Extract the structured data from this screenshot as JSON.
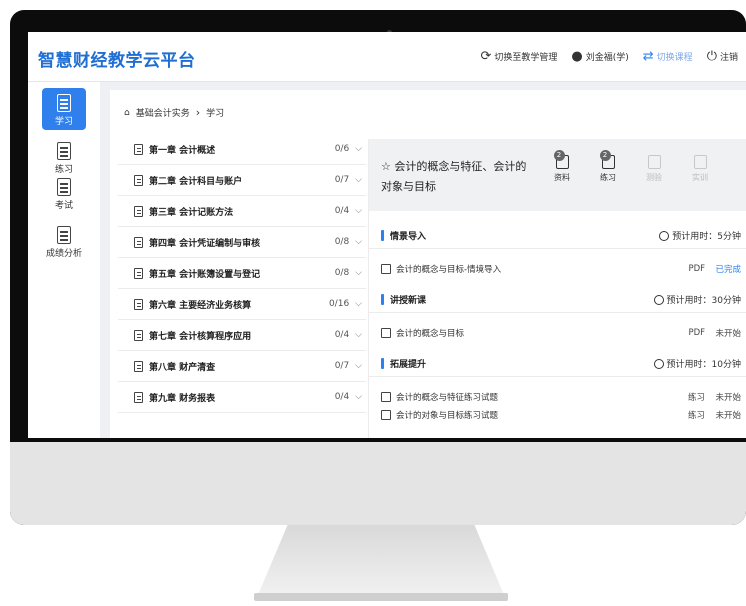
{
  "app": {
    "title": "智慧财经教学云平台"
  },
  "topnav": {
    "switch_admin": "切换至教学管理",
    "user": "刘金福(学)",
    "switch_course": "切换课程",
    "logout": "注销"
  },
  "sidebar": {
    "items": [
      {
        "label": "学习",
        "icon": "book-icon"
      },
      {
        "label": "练习",
        "icon": "document-icon"
      },
      {
        "label": "考试",
        "icon": "save-icon"
      },
      {
        "label": "成绩分析",
        "icon": "report-icon"
      }
    ]
  },
  "breadcrumb": {
    "course": "基础会计实务",
    "current": "学习"
  },
  "chapters": [
    {
      "title": "第一章 会计概述",
      "count": "0/6"
    },
    {
      "title": "第二章 会计科目与账户",
      "count": "0/7"
    },
    {
      "title": "第三章 会计记账方法",
      "count": "0/4"
    },
    {
      "title": "第四章 会计凭证编制与审核",
      "count": "0/8"
    },
    {
      "title": "第五章 会计账簿设置与登记",
      "count": "0/8"
    },
    {
      "title": "第六章 主要经济业务核算",
      "count": "0/16"
    },
    {
      "title": "第七章 会计核算程序应用",
      "count": "0/4"
    },
    {
      "title": "第八章 财产清查",
      "count": "0/7"
    },
    {
      "title": "第九章 财务报表",
      "count": "0/4"
    }
  ],
  "panel": {
    "title": "会计的概念与特征、会计的对象与目标",
    "resources": [
      {
        "label": "资料",
        "badge": "2",
        "icon": "materials-icon"
      },
      {
        "label": "练习",
        "badge": "2",
        "icon": "exercise-icon"
      },
      {
        "label": "测验",
        "icon": "quiz-icon"
      },
      {
        "label": "实训",
        "icon": "training-icon"
      }
    ],
    "sections": [
      {
        "title": "情景导入",
        "time": "预计用时：5分钟",
        "items": [
          {
            "title": "会计的概念与目标-情境导入",
            "type": "PDF",
            "status": "已完成"
          }
        ]
      },
      {
        "title": "讲授新课",
        "time": "预计用时：30分钟",
        "items": [
          {
            "title": "会计的概念与目标",
            "type": "PDF",
            "status": "未开始"
          }
        ]
      },
      {
        "title": "拓展提升",
        "time": "预计用时：10分钟",
        "items": [
          {
            "title": "会计的概念与特征练习试题",
            "type": "练习",
            "status": "未开始"
          },
          {
            "title": "会计的对象与目标练习试题",
            "type": "练习",
            "status": "未开始"
          }
        ]
      }
    ]
  },
  "colors": {
    "accent": "#2f80ed",
    "brand": "#1f6ed4"
  }
}
